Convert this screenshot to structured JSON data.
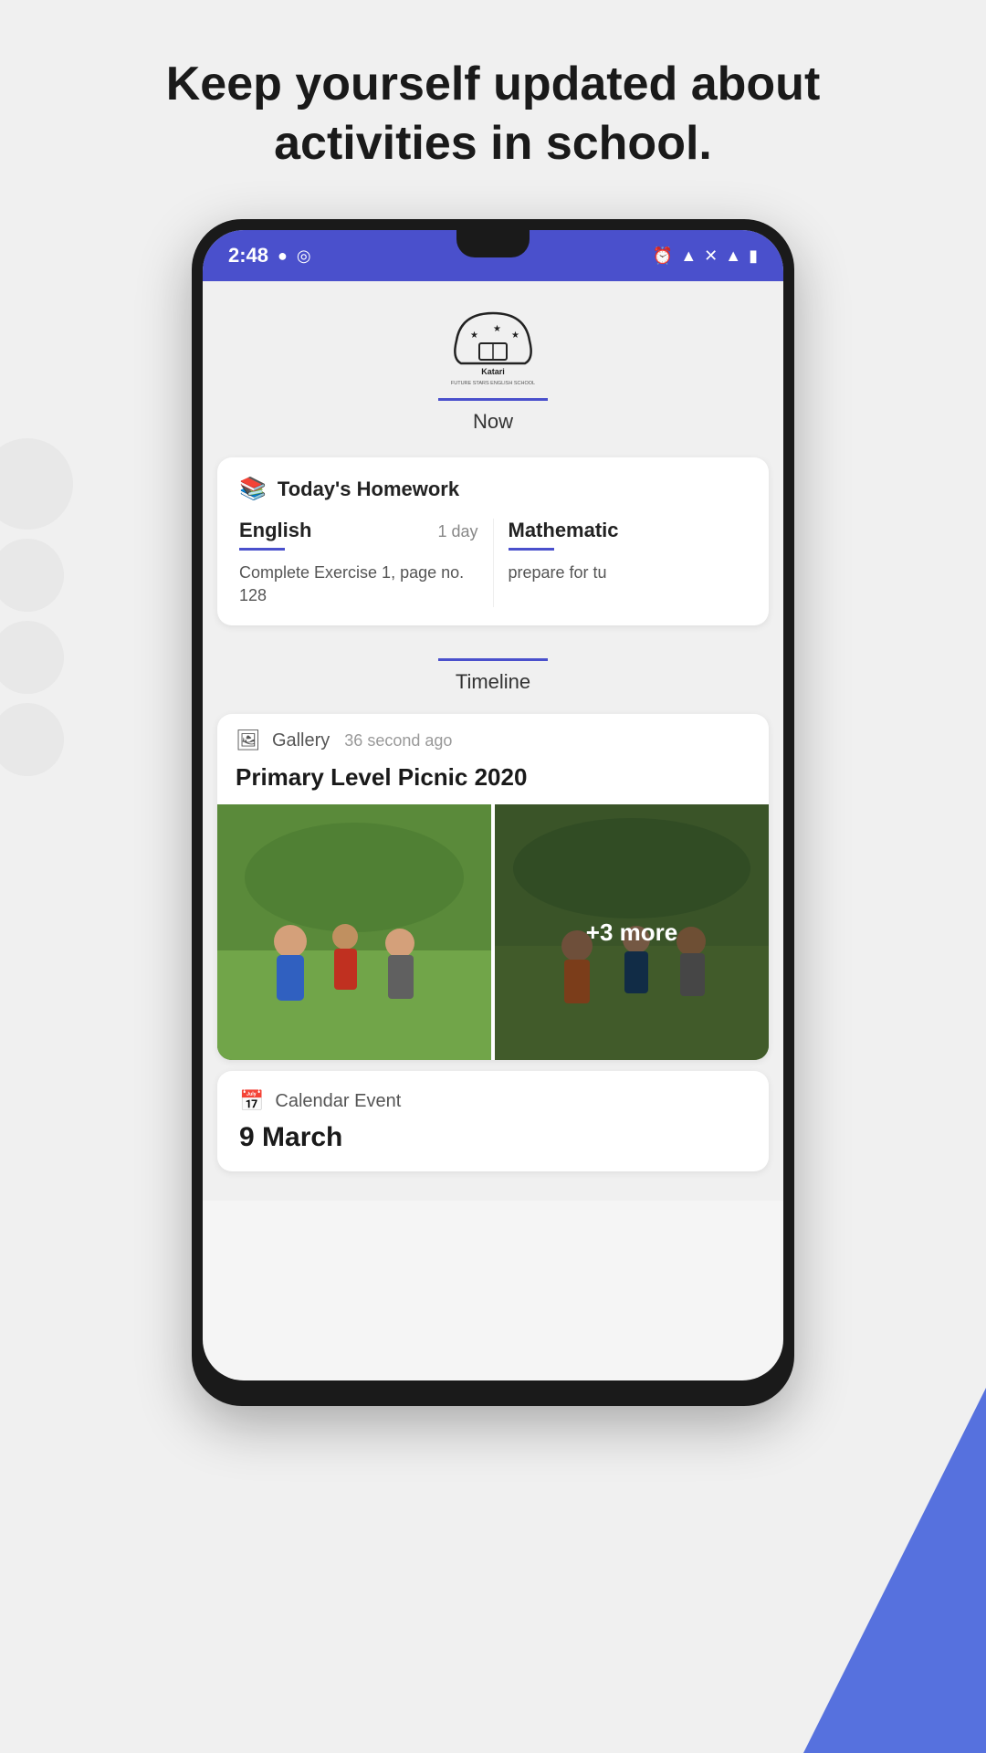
{
  "hero": {
    "title": "Keep yourself updated about activities in school."
  },
  "statusBar": {
    "time": "2:48",
    "leftIcons": [
      "●",
      "◎"
    ],
    "rightIcons": [
      "⏰",
      "▲",
      "✕",
      "▲▲",
      "🔋"
    ]
  },
  "school": {
    "name": "Katari",
    "subtitle": "FUTURE STARS ENGLISH SCHOOL",
    "tabLabel": "Now"
  },
  "homework": {
    "sectionTitle": "Today's Homework",
    "items": [
      {
        "subject": "English",
        "days": "1 day",
        "description": "Complete Exercise 1, page no. 128"
      },
      {
        "subject": "Mathematic",
        "days": "",
        "description": "prepare for tu"
      }
    ]
  },
  "timeline": {
    "tabLabel": "Timeline",
    "galleryPost": {
      "type": "Gallery",
      "timeAgo": "36 second ago",
      "title": "Primary Level Picnic 2020",
      "moreCount": "+3 more"
    },
    "calendarPost": {
      "type": "Calendar Event",
      "date": "9 March"
    }
  },
  "colors": {
    "primary": "#4a50cc",
    "text": "#1a1a1a",
    "subtext": "#555555",
    "bg": "#f0f0f0"
  }
}
